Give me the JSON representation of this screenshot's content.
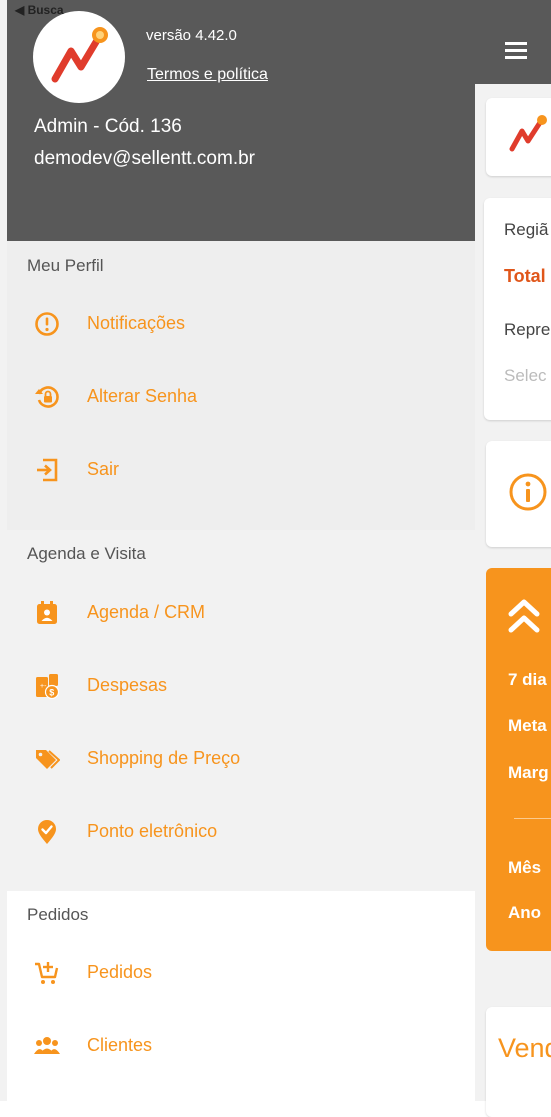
{
  "status": {
    "back_label": "◀ Busca"
  },
  "drawer": {
    "version": "versão 4.42.0",
    "terms_link": "Termos e política",
    "user_name": "Admin - Cód. 136",
    "user_email": "demodev@sellentt.com.br",
    "sections": [
      {
        "title": "Meu Perfil",
        "items": [
          {
            "label": "Notificações",
            "icon": "alert-circle-icon"
          },
          {
            "label": "Alterar Senha",
            "icon": "lock-reset-icon"
          },
          {
            "label": "Sair",
            "icon": "logout-icon"
          }
        ]
      },
      {
        "title": "Agenda e Visita",
        "items": [
          {
            "label": "Agenda / CRM",
            "icon": "calendar-account-icon"
          },
          {
            "label": "Despesas",
            "icon": "receipt-money-icon"
          },
          {
            "label": "Shopping de Preço",
            "icon": "price-tags-icon"
          },
          {
            "label": "Ponto eletrônico",
            "icon": "map-marker-check-icon"
          }
        ]
      },
      {
        "title": "Pedidos",
        "items": [
          {
            "label": "Pedidos",
            "icon": "cart-plus-icon"
          },
          {
            "label": "Clientes",
            "icon": "account-group-icon"
          }
        ]
      }
    ]
  },
  "background": {
    "filter_card": {
      "region": "Regiã",
      "total": "Total",
      "rep": "Repre",
      "select": "Selec"
    },
    "orange_card": {
      "line1": "7 dia",
      "line2": "Meta",
      "line3": "Marg",
      "line4": "Mês",
      "line5": "Ano"
    },
    "sales_title": "Vend"
  },
  "colors": {
    "accent": "#f7941d",
    "header_bg": "#595959",
    "logo_red": "#e03c2c"
  }
}
